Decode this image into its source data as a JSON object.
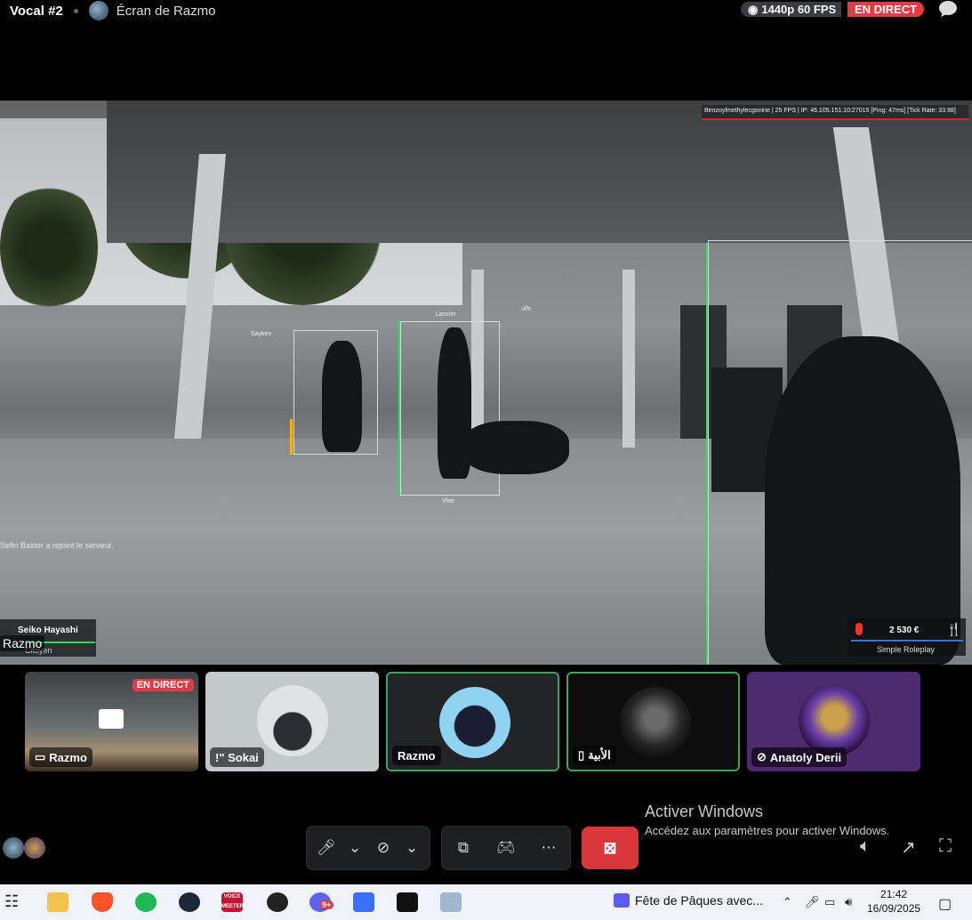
{
  "topbar": {
    "channel": "Vocal #2",
    "screen_title": "Écran de Razmo",
    "quality": "1440p 60 FPS",
    "live": "EN DIRECT"
  },
  "game_hud": {
    "server_info": "Benzoylmethylecgonine | 25 FPS | IP: 46.105.151.10:27015 [Ping: 47ms] [Tick Rate: 33.98]",
    "player_tags": [
      "Sayken",
      "Lancier",
      "Vlee",
      "ulfs"
    ],
    "join_message": "Sefin Baxter a rejoint le serveur.",
    "player_name": "Seiko Hayashi",
    "player_role": "Citoyen",
    "money": "2 530 €",
    "server_name": "Simple Roleplay",
    "streamer_label": "Razmo"
  },
  "tiles": [
    {
      "name": "Razmo",
      "live": "EN DIRECT",
      "icon": "screen-share-icon"
    },
    {
      "name": "!\" Sokai",
      "icon": null
    },
    {
      "name": "Razmo",
      "icon": null,
      "speaking": true
    },
    {
      "name": "الأبية",
      "icon": "phone-icon",
      "speaking": true
    },
    {
      "name": "Anatoly Derii",
      "icon": "video-off-icon"
    }
  ],
  "watermark": {
    "title": "Activer Windows",
    "subtitle": "Accédez aux paramètres pour activer Windows."
  },
  "taskbar": {
    "media_title": "Fête de Pâques avec...",
    "time": "21:42",
    "date": "16/09/2025",
    "voicemeeter_label": "VOICE MEETER",
    "discord_badge": "9+"
  },
  "colors": {
    "live_red": "#e23b45",
    "speaking_green": "#3ba55c",
    "end_call_red": "#da373c"
  }
}
